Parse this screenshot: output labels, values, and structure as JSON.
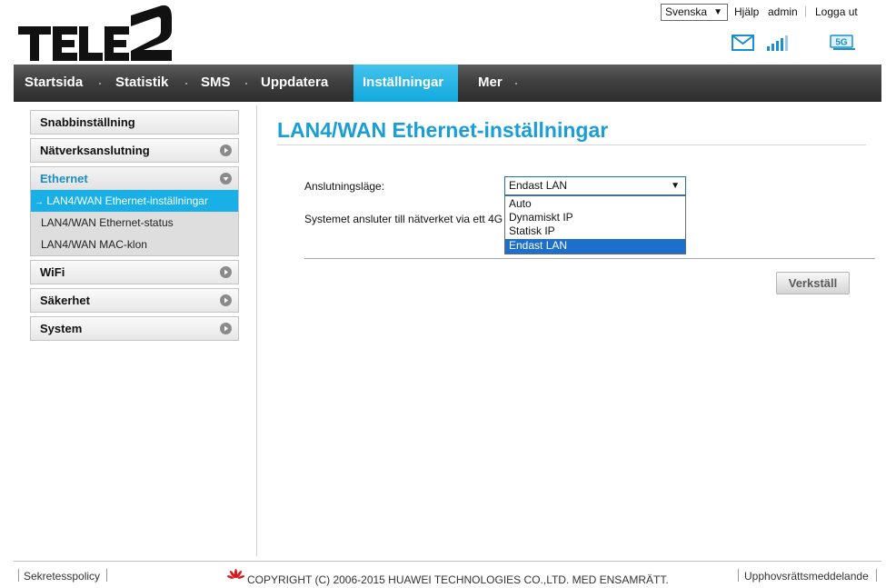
{
  "header": {
    "logo_text": "TELE2",
    "language_value": "Svenska",
    "help_label": "Hjälp",
    "user_label": "admin",
    "logout_label": "Logga ut"
  },
  "nav": {
    "items": [
      {
        "label": "Startsida"
      },
      {
        "label": "Statistik"
      },
      {
        "label": "SMS"
      },
      {
        "label": "Uppdatera"
      },
      {
        "label": "Inställningar",
        "active": true
      },
      {
        "label": "Mer"
      }
    ]
  },
  "sidebar": {
    "items": [
      {
        "label": "Snabbinställning"
      },
      {
        "label": "Nätverksanslutning"
      },
      {
        "label": "Ethernet",
        "expanded": true
      },
      {
        "label": "WiFi"
      },
      {
        "label": "Säkerhet"
      },
      {
        "label": "System"
      }
    ],
    "ethernet_sub": [
      {
        "label": "LAN4/WAN Ethernet-inställningar",
        "active": true
      },
      {
        "label": "LAN4/WAN Ethernet-status"
      },
      {
        "label": "LAN4/WAN MAC-klon"
      }
    ],
    "active_arrow": "→"
  },
  "main": {
    "title": "LAN4/WAN Ethernet-inställningar",
    "connection_mode_label": "Anslutningsläge:",
    "connection_mode_value": "Endast LAN",
    "options": [
      "Auto",
      "Dynamiskt IP",
      "Statisk IP",
      "Endast LAN"
    ],
    "info_text": "Systemet ansluter till nätverket via ett 4G",
    "apply_label": "Verkställ"
  },
  "footer": {
    "privacy_label": "Sekretesspolicy",
    "copyright": "COPYRIGHT (C) 2006-2015 HUAWEI TECHNOLOGIES CO.,LTD. MED ENSAMRÄTT.",
    "copyright_notice_label": "Upphovsrättsmeddelande"
  },
  "status": {
    "network_badge": "5G",
    "signal_bars": 5
  },
  "colors": {
    "accent": "#1a9ed6",
    "nav_active": "#19b0e8",
    "dropdown_selected": "#1d6fcc"
  }
}
